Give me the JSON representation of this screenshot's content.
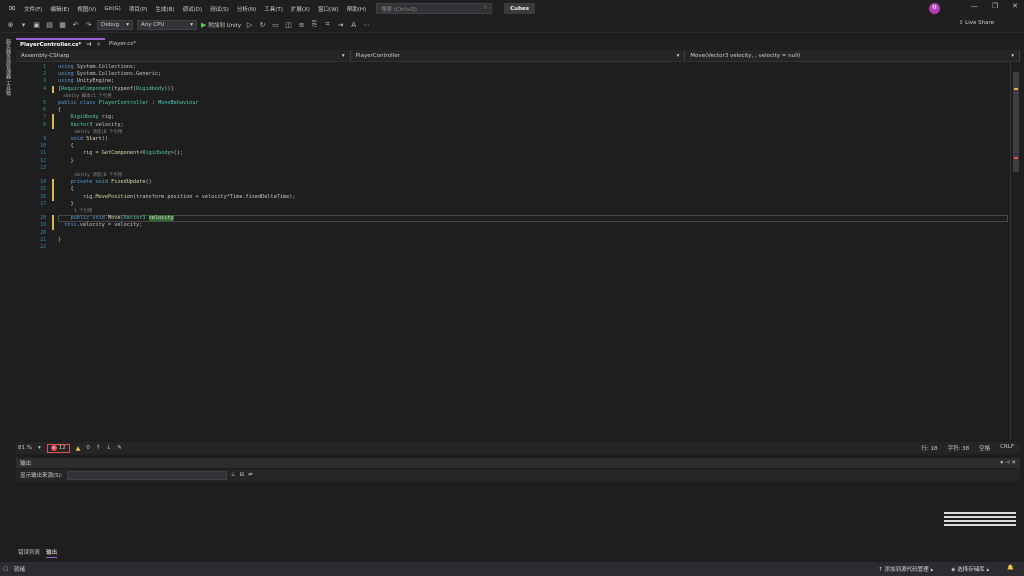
{
  "menubar": {
    "items": [
      "文件(F)",
      "编辑(E)",
      "视图(V)",
      "Git(G)",
      "项目(P)",
      "生成(B)",
      "调试(D)",
      "测试(S)",
      "分析(N)",
      "工具(T)",
      "扩展(X)",
      "窗口(W)",
      "帮助(H)"
    ],
    "search_placeholder": "搜索 (Ctrl+Q)",
    "solution_name": "Cubes",
    "avatar_initial": "林"
  },
  "toolbar": {
    "config": "Debug",
    "platform": "Any CPU",
    "run_label": "附加到 Unity",
    "live_share": "Live Share"
  },
  "side": {
    "label": "服务器资源管理器 工具箱"
  },
  "tabs": [
    {
      "label": "PlayerController.cs*",
      "active": true
    },
    {
      "label": "Player.cs*",
      "active": false
    }
  ],
  "navbar": {
    "project": "Assembly-CSharp",
    "class": "PlayerController",
    "member": "Move(Vector3 velocity, , velocity = null)"
  },
  "code": [
    {
      "n": "1",
      "text": "using System.Collections;"
    },
    {
      "n": "2",
      "text": "using System.Collections.Generic;"
    },
    {
      "n": "3",
      "text": "using UnityEngine;"
    },
    {
      "n": "4",
      "text": "[RequireComponent(typeof(Rigidbody))]"
    },
    {
      "n": "",
      "text": "  ⊙Unity 脚本|1 个引用",
      "lens": true
    },
    {
      "n": "5",
      "text": "public class PlayerController : MonoBehaviour"
    },
    {
      "n": "6",
      "text": "{"
    },
    {
      "n": "7",
      "text": "    Rigidbody rig;"
    },
    {
      "n": "8",
      "text": "    Vector3 velocity;"
    },
    {
      "n": "",
      "text": "      ⊙Unity 消息|0 个引用",
      "lens": true
    },
    {
      "n": "9",
      "text": "    void Start()"
    },
    {
      "n": "10",
      "text": "    {"
    },
    {
      "n": "11",
      "text": "        rig = GetComponent<Rigidbody>();"
    },
    {
      "n": "12",
      "text": "    }"
    },
    {
      "n": "13",
      "text": ""
    },
    {
      "n": "",
      "text": "      ⊙Unity 消息|0 个引用",
      "lens": true
    },
    {
      "n": "14",
      "text": "    private void FixedUpdate()"
    },
    {
      "n": "15",
      "text": "    {"
    },
    {
      "n": "16",
      "text": "        rig.MovePosition(transform.position + velocity*Time.fixedDeltaTime);"
    },
    {
      "n": "17",
      "text": "    }"
    },
    {
      "n": "",
      "text": "      1 个引用",
      "lens": true
    },
    {
      "n": "18",
      "text": "    public void Move(Vector3 velocity"
    },
    {
      "n": "19",
      "text": "  this.velocity = velocity;"
    },
    {
      "n": "20",
      "text": ""
    },
    {
      "n": "21",
      "text": "}"
    },
    {
      "n": "22",
      "text": ""
    }
  ],
  "editor_status": {
    "zoom": "81 %",
    "errors": "12",
    "warnings": "0",
    "line": "行: 18",
    "char": "字符: 38",
    "mode": "空格",
    "eol": "CRLF"
  },
  "output": {
    "title": "输出",
    "source_label": "显示输出来源(S):"
  },
  "bottom_tabs": [
    "错误列表",
    "输出"
  ],
  "statusbar": {
    "ready": "就绪",
    "source_control": "添加到源代码管理",
    "repo": "选择存储库"
  }
}
